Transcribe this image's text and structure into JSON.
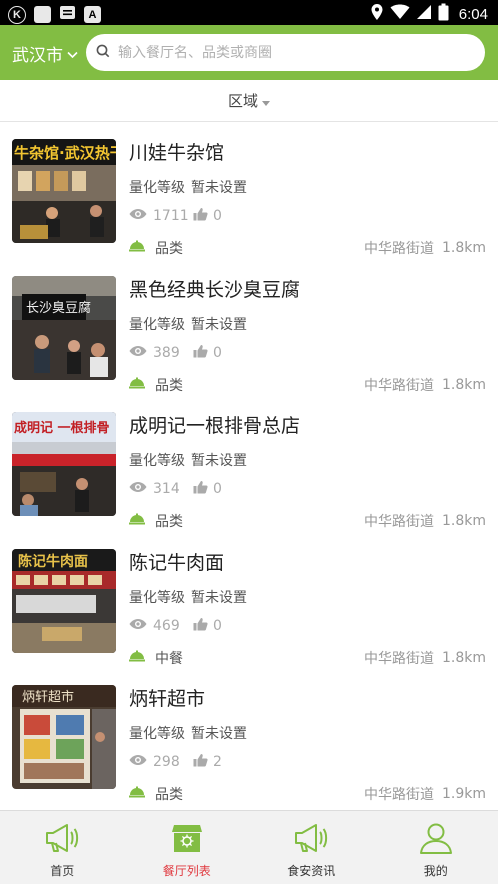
{
  "status_bar": {
    "time": "6:04",
    "left_icons": [
      "k-circle-icon",
      "square-icon",
      "message-icon",
      "a-icon"
    ],
    "right_icons": [
      "location-icon",
      "wifi-icon",
      "signal-icon",
      "battery-icon"
    ],
    "k_label": "K",
    "a_label": "A"
  },
  "header": {
    "city": "武汉市",
    "search_placeholder": "输入餐厅名、品类或商圈",
    "accent_color": "#82bd43"
  },
  "filter": {
    "label": "区域"
  },
  "restaurants": [
    {
      "name": "川娃牛杂馆",
      "rating_label": "量化等级",
      "rating_value": "暂未设置",
      "views": "1711",
      "likes": "0",
      "category": "品类",
      "location": "中华路街道",
      "distance": "1.8km",
      "sign_text": "牛杂馆·武汉热干面"
    },
    {
      "name": "黑色经典长沙臭豆腐",
      "rating_label": "量化等级",
      "rating_value": "暂未设置",
      "views": "389",
      "likes": "0",
      "category": "品类",
      "location": "中华路街道",
      "distance": "1.8km",
      "sign_text": "长沙臭豆腐"
    },
    {
      "name": "成明记一根排骨总店",
      "rating_label": "量化等级",
      "rating_value": "暂未设置",
      "views": "314",
      "likes": "0",
      "category": "品类",
      "location": "中华路街道",
      "distance": "1.8km",
      "sign_text": "成明记 一根排骨"
    },
    {
      "name": "陈记牛肉面",
      "rating_label": "量化等级",
      "rating_value": "暂未设置",
      "views": "469",
      "likes": "0",
      "category": "中餐",
      "location": "中华路街道",
      "distance": "1.8km",
      "sign_text": "陈记牛肉面"
    },
    {
      "name": "炳轩超市",
      "rating_label": "量化等级",
      "rating_value": "暂未设置",
      "views": "298",
      "likes": "2",
      "category": "品类",
      "location": "中华路街道",
      "distance": "1.9km",
      "sign_text": "炳轩超市"
    }
  ],
  "tabs": [
    {
      "label": "首页",
      "icon": "megaphone-icon",
      "active": false
    },
    {
      "label": "餐厅列表",
      "icon": "storefront-icon",
      "active": true
    },
    {
      "label": "食安资讯",
      "icon": "megaphone-icon",
      "active": false
    },
    {
      "label": "我的",
      "icon": "user-icon",
      "active": false
    }
  ],
  "colors": {
    "accent_green": "#82bd43",
    "active_tab_red": "#e0383e",
    "stat_grey": "#aaaaaa"
  }
}
